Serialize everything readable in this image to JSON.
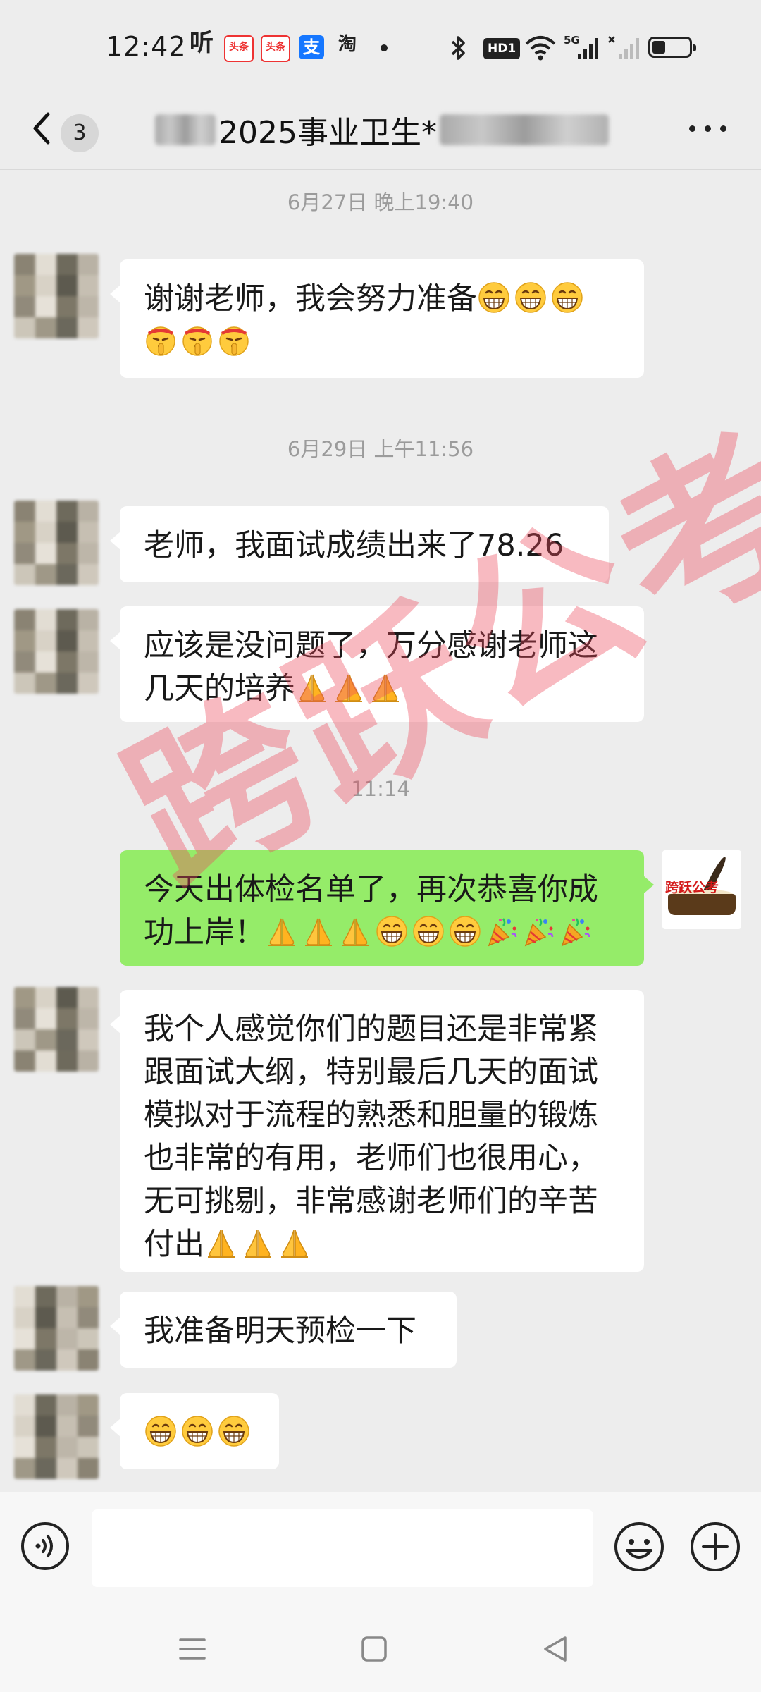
{
  "status_bar": {
    "time": "12:42",
    "app_icons": [
      "听",
      "头条",
      "头条",
      "支",
      "淘"
    ],
    "hd_label": "HD1",
    "network_label": "5G"
  },
  "nav": {
    "unread_count": "3",
    "title": "2025事业卫生*"
  },
  "messages": [
    {
      "type": "timestamp",
      "text": "6月27日 晚上19:40"
    },
    {
      "type": "msg",
      "side": "left",
      "text": "谢谢老师，我会努力准备",
      "emojis": [
        "grin",
        "grin",
        "grin",
        "shush",
        "shush",
        "shush"
      ]
    },
    {
      "type": "timestamp",
      "text": "6月29日 上午11:56"
    },
    {
      "type": "msg",
      "side": "left",
      "text": "老师，我面试成绩出来了78.26",
      "emojis": []
    },
    {
      "type": "msg",
      "side": "left",
      "text": "应该是没问题了，万分感谢老师这几天的培养",
      "emojis": [
        "pray",
        "pray",
        "pray"
      ]
    },
    {
      "type": "timestamp",
      "text": "11:14"
    },
    {
      "type": "msg",
      "side": "right",
      "text": "今天出体检名单了，再次恭喜你成功上岸！",
      "emojis": [
        "pray",
        "pray",
        "pray",
        "grin",
        "grin",
        "grin",
        "party",
        "party",
        "party"
      ]
    },
    {
      "type": "msg",
      "side": "left",
      "text": "我个人感觉你们的题目还是非常紧跟面试大纲，特别最后几天的面试模拟对于流程的熟悉和胆量的锻炼也非常的有用，老师们也很用心，无可挑剔，非常感谢老师们的辛苦付出",
      "emojis": [
        "pray",
        "pray",
        "pray"
      ]
    },
    {
      "type": "msg",
      "side": "left",
      "text": "我准备明天预检一下",
      "emojis": []
    },
    {
      "type": "msg",
      "side": "left",
      "text": "",
      "emojis": [
        "grin",
        "grin",
        "grin"
      ]
    }
  ],
  "my_avatar_text": "跨跃公考",
  "watermark": "跨跃公考",
  "input": {
    "placeholder": "",
    "value": ""
  },
  "colors": {
    "my_bubble": "#95ec69",
    "their_bubble": "#ffffff",
    "background": "#ededed",
    "watermark": "#ec4a5c"
  }
}
